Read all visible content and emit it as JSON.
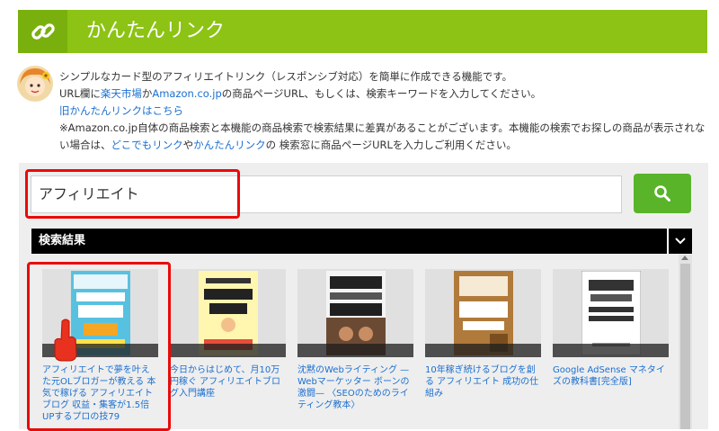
{
  "header": {
    "title": "かんたんリンク",
    "icon": "link-icon"
  },
  "description": {
    "line1": "シンプルなカード型のアフィリエイトリンク（レスポンシブ対応）を簡単に作成できる機能です。",
    "line2_pre": "URL欄に",
    "rakuten_link": "楽天市場",
    "line2_mid": "か",
    "amazon_link": "Amazon.co.jp",
    "line2_post": "の商品ページURL、もしくは、検索キーワードを入力してください。",
    "old_link": "旧かんたんリンクはこちら",
    "note_line1": "※Amazon.co.jp自体の商品検索と本機能の商品検索で検索結果に差異があることがございます。本機能の検索でお探しの商品が表示されな",
    "note_line2_pre": "い場合は、",
    "dokodemo_link": "どこでもリンク",
    "note_line2_mid": "や",
    "kantan_link": "かんたんリンク",
    "note_line2_post": "の 検索窓に商品ページURLを入力しご利用ください。"
  },
  "search": {
    "value": "アフィリエイト",
    "button_icon": "search-icon"
  },
  "results": {
    "label": "検索結果",
    "items": [
      {
        "title": "アフィリエイトで夢を叶えた元OLブロガーが教える 本気で稼げる アフィリエイトブログ 収益・集客が1.5倍UPするプロの技79",
        "cover_color": "#59c1e0",
        "cover_text": "アフィリエイトブログ"
      },
      {
        "title": "今日からはじめて、月10万円稼ぐ アフィリエイトブログ入門講座",
        "cover_color": "#fff6b0",
        "cover_text": "アフィリエイトブログ入門講座"
      },
      {
        "title": "沈黙のWebライティング —Webマーケッター ボーンの激闘— 〈SEOのためのライティング教本〉",
        "cover_color": "#2b2b2b",
        "cover_text": "沈黙のWebライティング"
      },
      {
        "title": "10年稼ぎ続けるブログを創る アフィリエイト 成功の仕組み",
        "cover_color": "#b07a3a",
        "cover_text": "アフィリエイト"
      },
      {
        "title": "Google AdSense マネタイズの教科書[完全版]",
        "cover_color": "#ffffff",
        "cover_text": "Google AdSense"
      }
    ]
  },
  "colors": {
    "brand": "#8cc314",
    "search_button": "#59b42a",
    "highlight": "#ea0a0a",
    "link": "#1a6fd1"
  }
}
